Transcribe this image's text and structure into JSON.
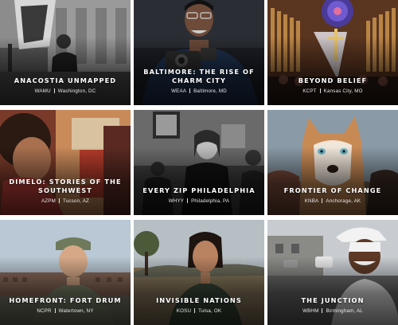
{
  "tiles": [
    {
      "title": "ANACOSTIA UNMAPPED",
      "station": "WAMU",
      "location": "Washington, DC"
    },
    {
      "title": "BALTIMORE: THE RISE OF CHARM CITY",
      "station": "WEAA",
      "location": "Baltimore, MD"
    },
    {
      "title": "BEYOND BELIEF",
      "station": "KCPT",
      "location": "Kansas City, MO"
    },
    {
      "title": "DIMELO: STORIES OF THE SOUTHWEST",
      "station": "AZPM",
      "location": "Tucson, AZ"
    },
    {
      "title": "EVERY ZIP PHILADELPHIA",
      "station": "WHYY",
      "location": "Philadelphia, PA"
    },
    {
      "title": "FRONTIER OF CHANGE",
      "station": "KNBA",
      "location": "Anchorage, AK"
    },
    {
      "title": "HOMEFRONT: FORT DRUM",
      "station": "NCPR",
      "location": "Watertown, NY"
    },
    {
      "title": "INVISIBLE NATIONS",
      "station": "KOSU",
      "location": "Tulsa, OK"
    },
    {
      "title": "THE JUNCTION",
      "station": "WBHM",
      "location": "Birmingham, AL"
    }
  ]
}
